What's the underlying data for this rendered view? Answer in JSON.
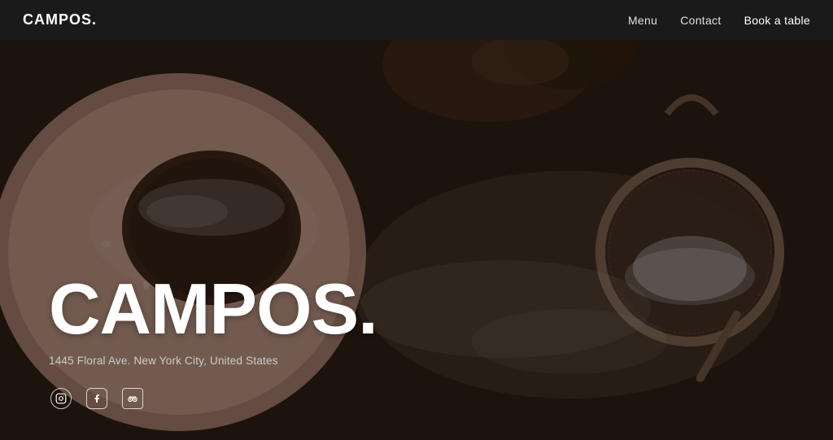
{
  "navbar": {
    "logo": "CAMPOS.",
    "links": [
      {
        "label": "Menu",
        "key": "menu"
      },
      {
        "label": "Contact",
        "key": "contact"
      },
      {
        "label": "Book a table",
        "key": "book",
        "class": "book"
      }
    ]
  },
  "hero": {
    "title": "CAMPOS.",
    "address": "1445 Floral Ave. New York City, United States",
    "bg_color": "#2c1f18"
  },
  "social": {
    "icons": [
      {
        "name": "instagram",
        "symbol": "𝄇"
      },
      {
        "name": "facebook",
        "symbol": "f"
      },
      {
        "name": "tripadvisor",
        "symbol": "✈"
      }
    ]
  }
}
